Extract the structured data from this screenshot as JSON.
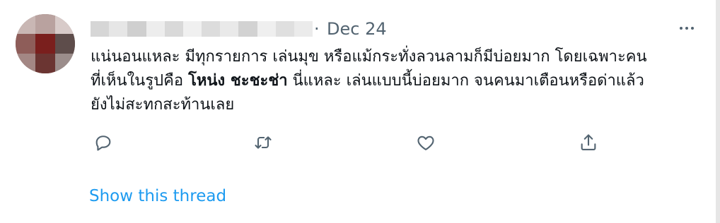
{
  "tweet": {
    "separator": "·",
    "date": "Dec 24",
    "text_parts": {
      "line1": "แน่นอนแหละ มีทุกรายการ เล่นมุข หรือแม้กระทั่งลวนลามก็มีบ่อยมาก โดยเฉพาะคน",
      "line2_before": "ที่เห็นในรูปคือ ",
      "line2_bold": "โหน่ง ชะชะช่า",
      "line2_after": " นี่แหละ เล่นแบบนี้บ่อยมาก จนคนมาเตือนหรือด่าแล้ว",
      "line3": "ยังไม่สะทกสะท้านเลย"
    },
    "show_thread": "Show this thread"
  },
  "icons": {
    "reply": "reply-icon",
    "retweet": "retweet-icon",
    "like": "heart-icon",
    "share": "share-icon",
    "more": "more-icon"
  },
  "colors": {
    "text": "#0f1419",
    "secondary": "#536471",
    "link": "#1d9bf0"
  }
}
